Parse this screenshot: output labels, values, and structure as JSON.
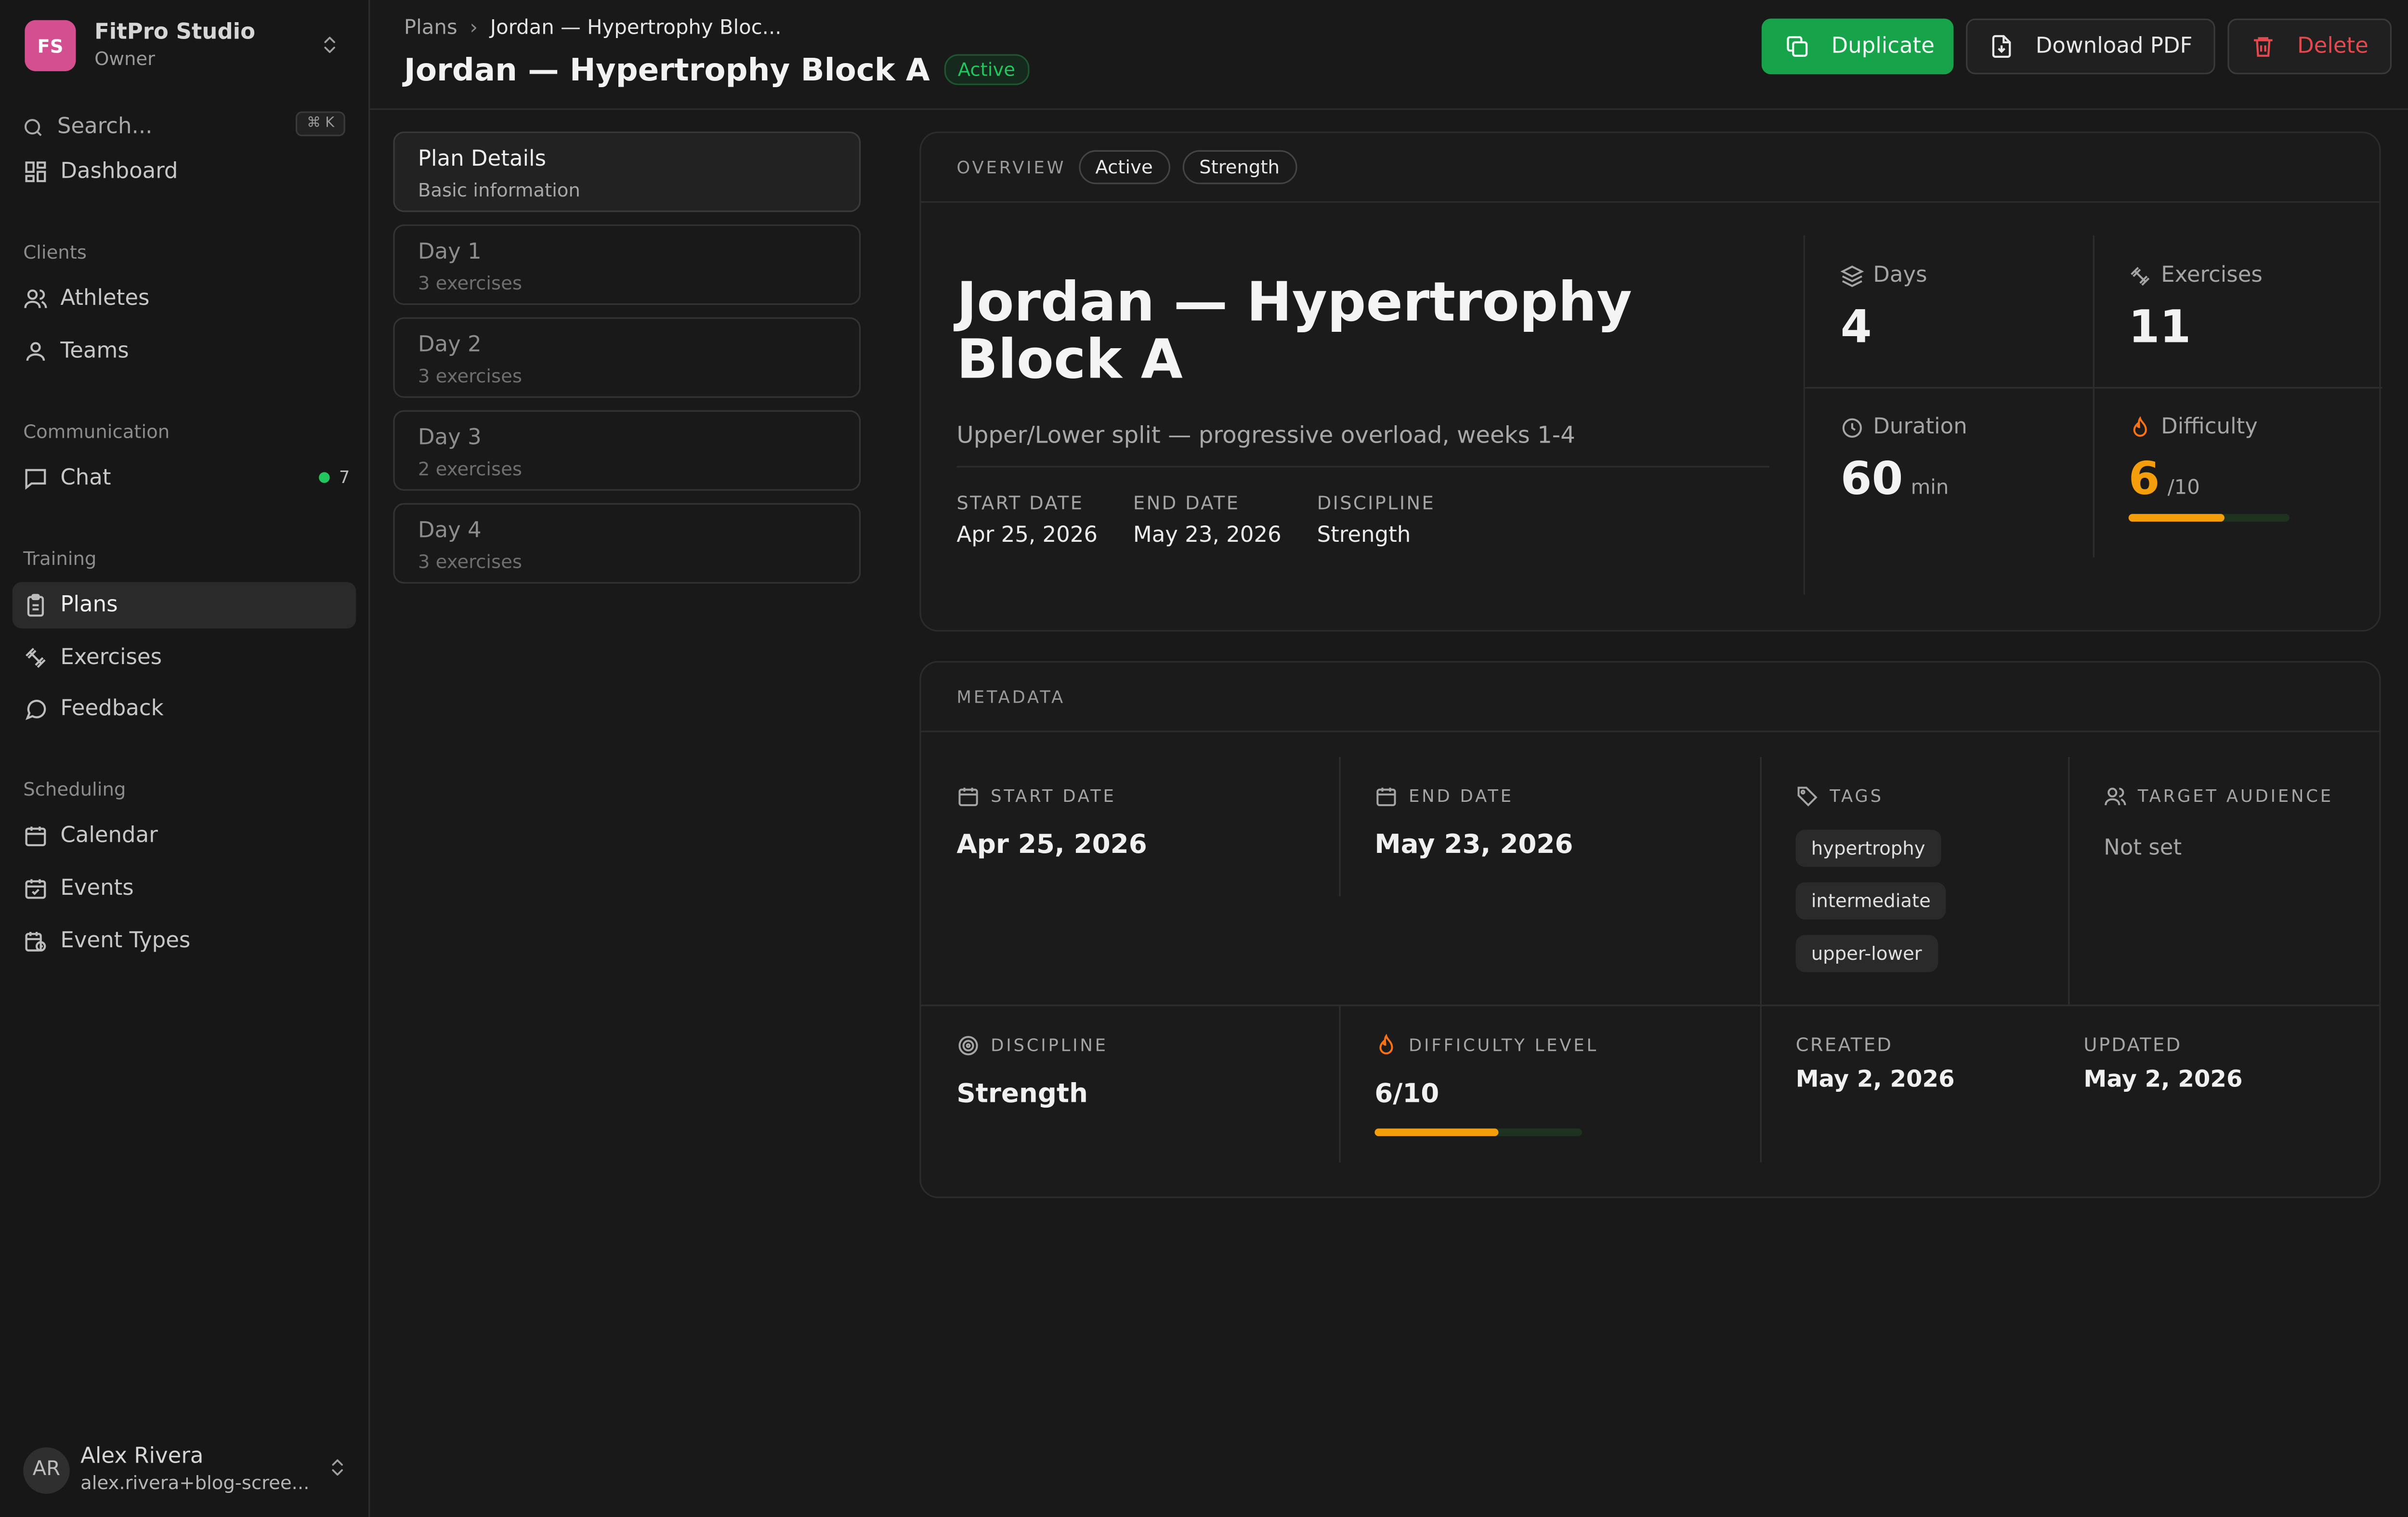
{
  "sidebar": {
    "brand": {
      "initials": "FS",
      "name": "FitPro Studio",
      "role": "Owner",
      "color": "#d34f8f"
    },
    "search": {
      "placeholder": "Search...",
      "shortcut": "⌘ K"
    },
    "dashboard": "Dashboard",
    "sections": {
      "clients": {
        "label": "Clients",
        "items": [
          "Athletes",
          "Teams"
        ]
      },
      "communication": {
        "label": "Communication",
        "items": [
          "Chat"
        ],
        "chat_count": "7"
      },
      "training": {
        "label": "Training",
        "items": [
          "Plans",
          "Exercises",
          "Feedback"
        ]
      },
      "scheduling": {
        "label": "Scheduling",
        "items": [
          "Calendar",
          "Events",
          "Event Types"
        ]
      }
    },
    "user": {
      "initials": "AR",
      "name": "Alex Rivera",
      "email": "alex.rivera+blog-scree..."
    }
  },
  "header": {
    "breadcrumb": {
      "root": "Plans",
      "current": "Jordan — Hypertrophy Bloc..."
    },
    "title": "Jordan — Hypertrophy Block A",
    "status": "Active",
    "buttons": {
      "duplicate": "Duplicate",
      "download": "Download PDF",
      "delete": "Delete"
    }
  },
  "tabs": [
    {
      "title": "Plan Details",
      "sub": "Basic information"
    },
    {
      "title": "Day 1",
      "sub": "3 exercises"
    },
    {
      "title": "Day 2",
      "sub": "3 exercises"
    },
    {
      "title": "Day 3",
      "sub": "2 exercises"
    },
    {
      "title": "Day 4",
      "sub": "3 exercises"
    }
  ],
  "overview": {
    "label": "Overview",
    "chips": [
      "Active",
      "Strength"
    ],
    "title": "Jordan — Hypertrophy Block A",
    "description": "Upper/Lower split — progressive overload, weeks 1-4",
    "start_label": "Start Date",
    "start": "Apr 25, 2026",
    "end_label": "End Date",
    "end": "May 23, 2026",
    "discipline_label": "Discipline",
    "discipline": "Strength",
    "stats": {
      "days_label": "Days",
      "days": "4",
      "exercises_label": "Exercises",
      "exercises": "11",
      "duration_label": "Duration",
      "duration": "60",
      "duration_unit": "min",
      "difficulty_label": "Difficulty",
      "difficulty": "6",
      "difficulty_max": "/10",
      "difficulty_fraction": 0.6
    }
  },
  "metadata": {
    "label": "Metadata",
    "start_label": "Start Date",
    "start": "Apr 25, 2026",
    "end_label": "End Date",
    "end": "May 23, 2026",
    "tags_label": "Tags",
    "tags": [
      "hypertrophy",
      "intermediate",
      "upper-lower"
    ],
    "audience_label": "Target Audience",
    "audience": "Not set",
    "discipline_label": "Discipline",
    "discipline": "Strength",
    "difficulty_label": "Difficulty Level",
    "difficulty": "6/10",
    "difficulty_fraction": 0.6,
    "created_label": "Created",
    "created": "May 2, 2026",
    "updated_label": "Updated",
    "updated": "May 2, 2026"
  },
  "colors": {
    "accent_green": "#16a34a",
    "danger": "#e5484d",
    "difficulty": "#f59e0b",
    "flame": "#f97316"
  }
}
